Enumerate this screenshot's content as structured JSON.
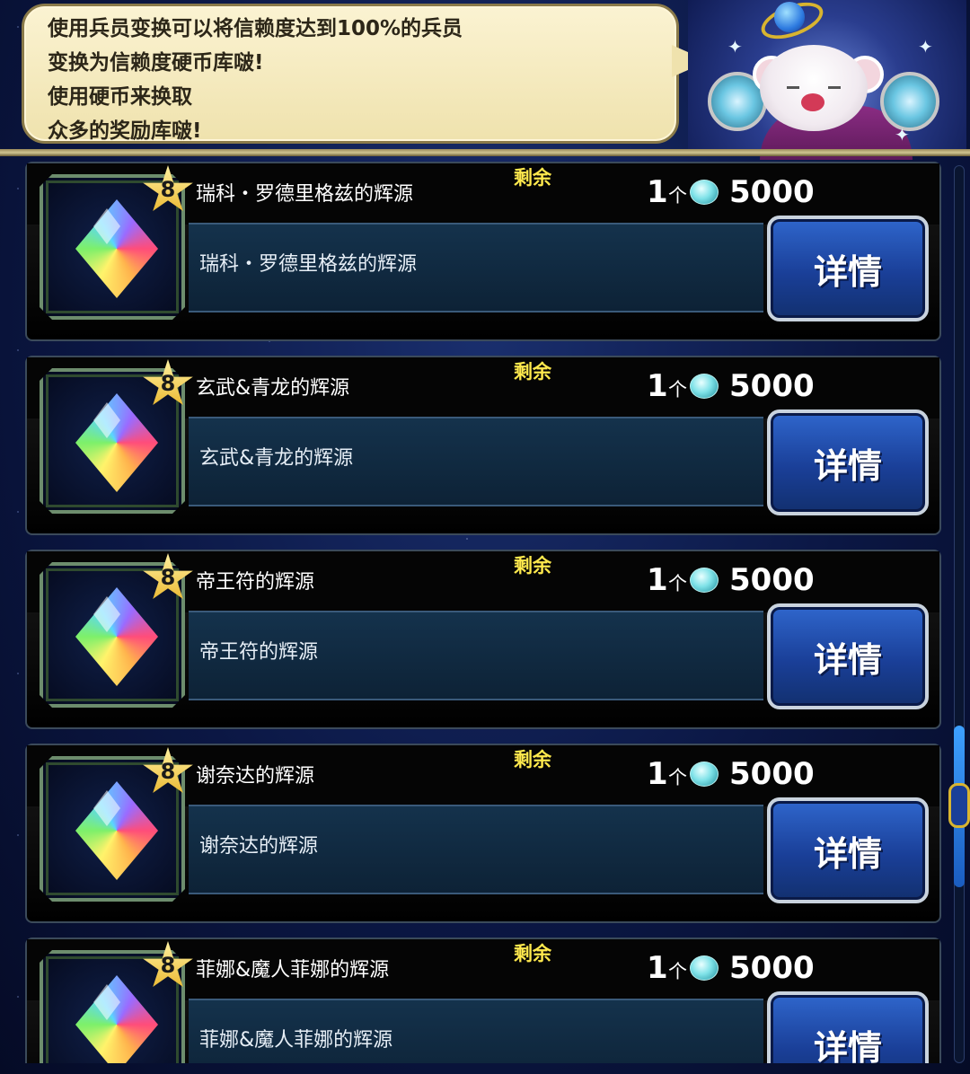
{
  "header": {
    "message_lines": [
      "使用兵员变换可以将信赖度达到100%的兵员",
      "变换为信赖度硬币库啵!",
      "使用硬币来换取",
      "众多的奖励库啵!"
    ]
  },
  "shop": {
    "remain_label": "剩余",
    "detail_label": "详情",
    "unit": "个",
    "currency_icon": "trust-coin-icon",
    "items": [
      {
        "stars": "8",
        "name": "瑞科・罗德里格兹的辉源",
        "desc": "瑞科・罗德里格兹的辉源",
        "qty": "1",
        "price": "5000"
      },
      {
        "stars": "8",
        "name": "玄武&青龙的辉源",
        "desc": "玄武&青龙的辉源",
        "qty": "1",
        "price": "5000"
      },
      {
        "stars": "8",
        "name": "帝王符的辉源",
        "desc": "帝王符的辉源",
        "qty": "1",
        "price": "5000"
      },
      {
        "stars": "8",
        "name": "谢奈达的辉源",
        "desc": "谢奈达的辉源",
        "qty": "1",
        "price": "5000"
      },
      {
        "stars": "8",
        "name": "菲娜&魔人菲娜的辉源",
        "desc": "菲娜&魔人菲娜的辉源",
        "qty": "1",
        "price": "5000"
      }
    ]
  }
}
